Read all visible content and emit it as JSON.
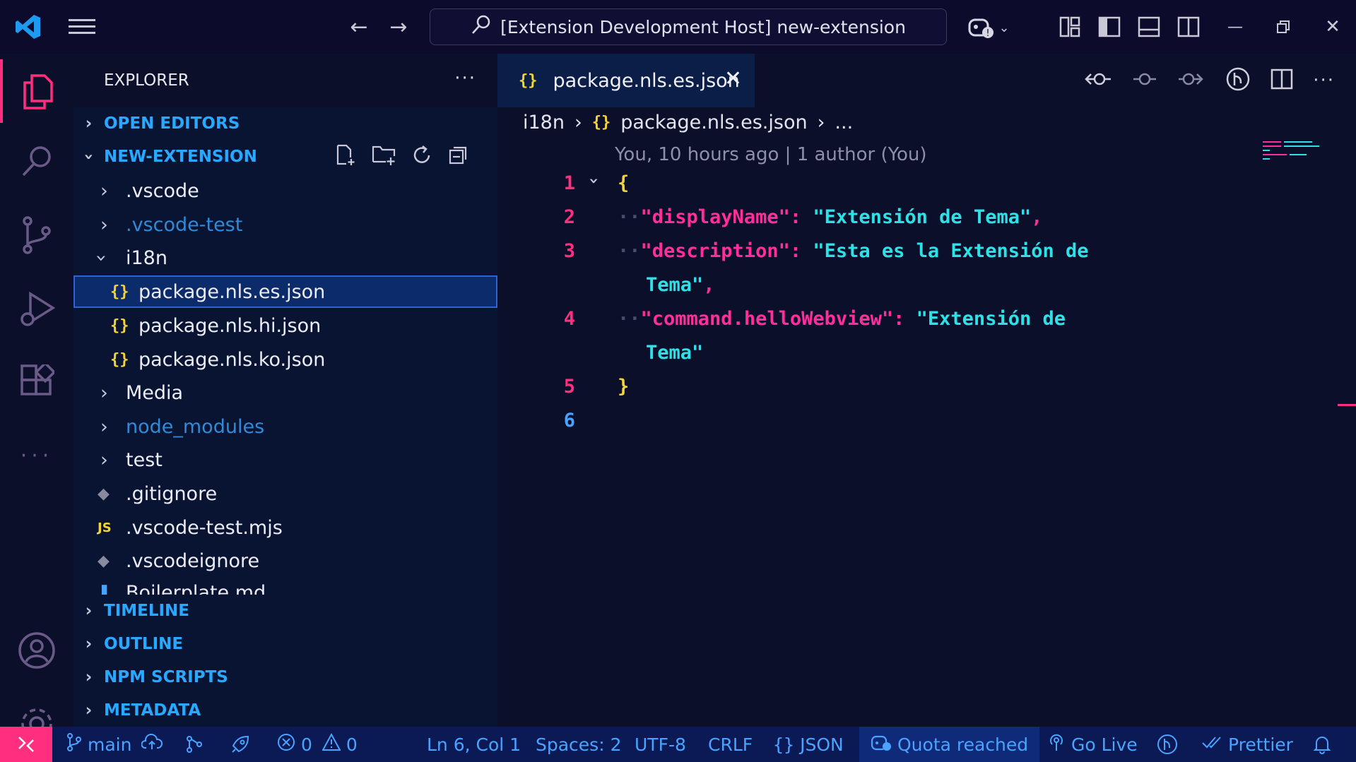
{
  "titlebar": {
    "search_text": "[Extension Development Host] new-extension"
  },
  "sidebar": {
    "header": "EXPLORER",
    "open_editors": "OPEN EDITORS",
    "project": "NEW-EXTENSION",
    "tree": [
      {
        "label": ".vscode",
        "type": "folder",
        "expanded": false
      },
      {
        "label": ".vscode-test",
        "type": "folder",
        "expanded": false,
        "dim": true
      },
      {
        "label": "i18n",
        "type": "folder",
        "expanded": true
      },
      {
        "label": "package.nls.es.json",
        "type": "json",
        "selected": true
      },
      {
        "label": "package.nls.hi.json",
        "type": "json"
      },
      {
        "label": "package.nls.ko.json",
        "type": "json"
      },
      {
        "label": "Media",
        "type": "folder",
        "expanded": false
      },
      {
        "label": "node_modules",
        "type": "folder",
        "expanded": false,
        "dim": true
      },
      {
        "label": "test",
        "type": "folder",
        "expanded": false
      },
      {
        "label": ".gitignore",
        "type": "git"
      },
      {
        "label": ".vscode-test.mjs",
        "type": "js"
      },
      {
        "label": ".vscodeignore",
        "type": "git"
      },
      {
        "label": "Boilerplate.md",
        "type": "md"
      }
    ],
    "sections": [
      "TIMELINE",
      "OUTLINE",
      "NPM SCRIPTS",
      "METADATA"
    ]
  },
  "editor": {
    "tab_label": "package.nls.es.json",
    "breadcrumb": [
      "i18n",
      "package.nls.es.json",
      "..."
    ],
    "blame": "You, 10 hours ago | 1 author (You)",
    "line_numbers": [
      "1",
      "2",
      "3",
      "",
      "4",
      "",
      "5",
      "6"
    ],
    "code": {
      "open": "{",
      "k1": "\"displayName\"",
      "v1": "\"Extensión de Tema\"",
      "k2": "\"description\"",
      "v2a": "\"Esta es la Extensión de",
      "v2b": "Tema\"",
      "k3": "\"command.helloWebview\"",
      "v3a": "\"Extensión de",
      "v3b": "Tema\"",
      "close": "}"
    }
  },
  "statusbar": {
    "branch": "main",
    "errors": "0",
    "warnings": "0",
    "position": "Ln 6, Col 1",
    "spaces": "Spaces: 2",
    "encoding": "UTF-8",
    "eol": "CRLF",
    "language": "JSON",
    "quota": "Quota reached",
    "golive": "Go Live",
    "prettier": "Prettier"
  },
  "colors": {
    "accent": "#ff2e7e",
    "key": "#ff2e9a",
    "string": "#2de2e6",
    "brace": "#f2d33c",
    "status_text": "#4aa3ff"
  }
}
